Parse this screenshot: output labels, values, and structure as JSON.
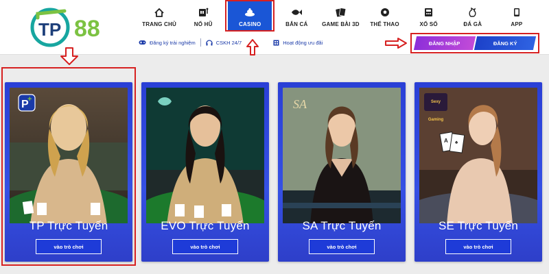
{
  "logo": {
    "text": "88",
    "mark": "TP",
    "colors": {
      "teal": "#17a6a0",
      "green": "#7cc242",
      "navy": "#1d3f7a"
    }
  },
  "nav": [
    {
      "label": "TRANG CHỦ",
      "icon": "home-icon"
    },
    {
      "label": "NỔ HŨ",
      "icon": "slot-machine-icon"
    },
    {
      "label": "CASINO",
      "icon": "casino-chip-icon",
      "active": true
    },
    {
      "label": "BẮN CÁ",
      "icon": "fish-icon"
    },
    {
      "label": "GAME BÀI 3D",
      "icon": "cards-icon"
    },
    {
      "label": "THỂ THAO",
      "icon": "soccer-ball-icon"
    },
    {
      "label": "XỔ SỐ",
      "icon": "lottery-icon"
    },
    {
      "label": "ĐÁ GÀ",
      "icon": "rooster-icon"
    },
    {
      "label": "APP",
      "icon": "phone-icon"
    }
  ],
  "subbar": {
    "trial": "Đăng ký trải nghiệm",
    "support": "CSKH 24/7",
    "promo": "Hoạt động ưu đãi"
  },
  "auth": {
    "login": "ĐĂNG NHẬP",
    "register": "ĐĂNG KÝ"
  },
  "cards": [
    {
      "title": "TP Trực Tuyến",
      "button": "vào trò chơi",
      "brand": "tp-plus-logo"
    },
    {
      "title": "EVO Trực Tuyến",
      "button": "vào trò chơi",
      "brand": "evo-leaf-logo"
    },
    {
      "title": "SA Trực Tuyến",
      "button": "vào trò chơi",
      "brand": "SA"
    },
    {
      "title": "SE Trực Tuyến",
      "button": "vào trò chơi",
      "brand": "Sexy Gaming"
    }
  ],
  "colors": {
    "accent": "#1a56d6",
    "annotation": "#d62020",
    "card": "#2a3fd6"
  }
}
